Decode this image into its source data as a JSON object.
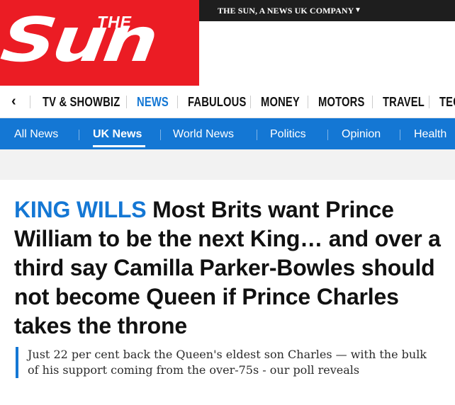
{
  "header": {
    "logo": {
      "the": "THE",
      "sun": "Sun"
    },
    "company_label": "THE SUN, A NEWS UK COMPANY",
    "company_caret": "▼"
  },
  "section_nav": {
    "back_icon": "‹",
    "items": [
      {
        "label": "TV & SHOWBIZ"
      },
      {
        "label": "NEWS",
        "active": true
      },
      {
        "label": "FABULOUS"
      },
      {
        "label": "MONEY"
      },
      {
        "label": "MOTORS"
      },
      {
        "label": "TRAVEL"
      },
      {
        "label": "TECH"
      }
    ]
  },
  "sub_nav": {
    "items": [
      {
        "label": "All News"
      },
      {
        "label": "UK News",
        "active": true
      },
      {
        "label": "World News"
      },
      {
        "label": "Politics"
      },
      {
        "label": "Opinion"
      },
      {
        "label": "Health"
      }
    ]
  },
  "article": {
    "kicker": "KING WILLS",
    "headline": "Most Brits want Prince William to be the next King… and over a third say Camilla Parker-Bowles should not become Queen if Prince Charles takes the throne",
    "standfirst": "Just 22 per cent back the Queen's eldest son Charles — with the bulk of his support coming from the over-75s - our poll reveals"
  },
  "colors": {
    "brand_red": "#eb1c24",
    "accent_blue": "#1477d4",
    "company_bar": "#1e1e1e"
  }
}
